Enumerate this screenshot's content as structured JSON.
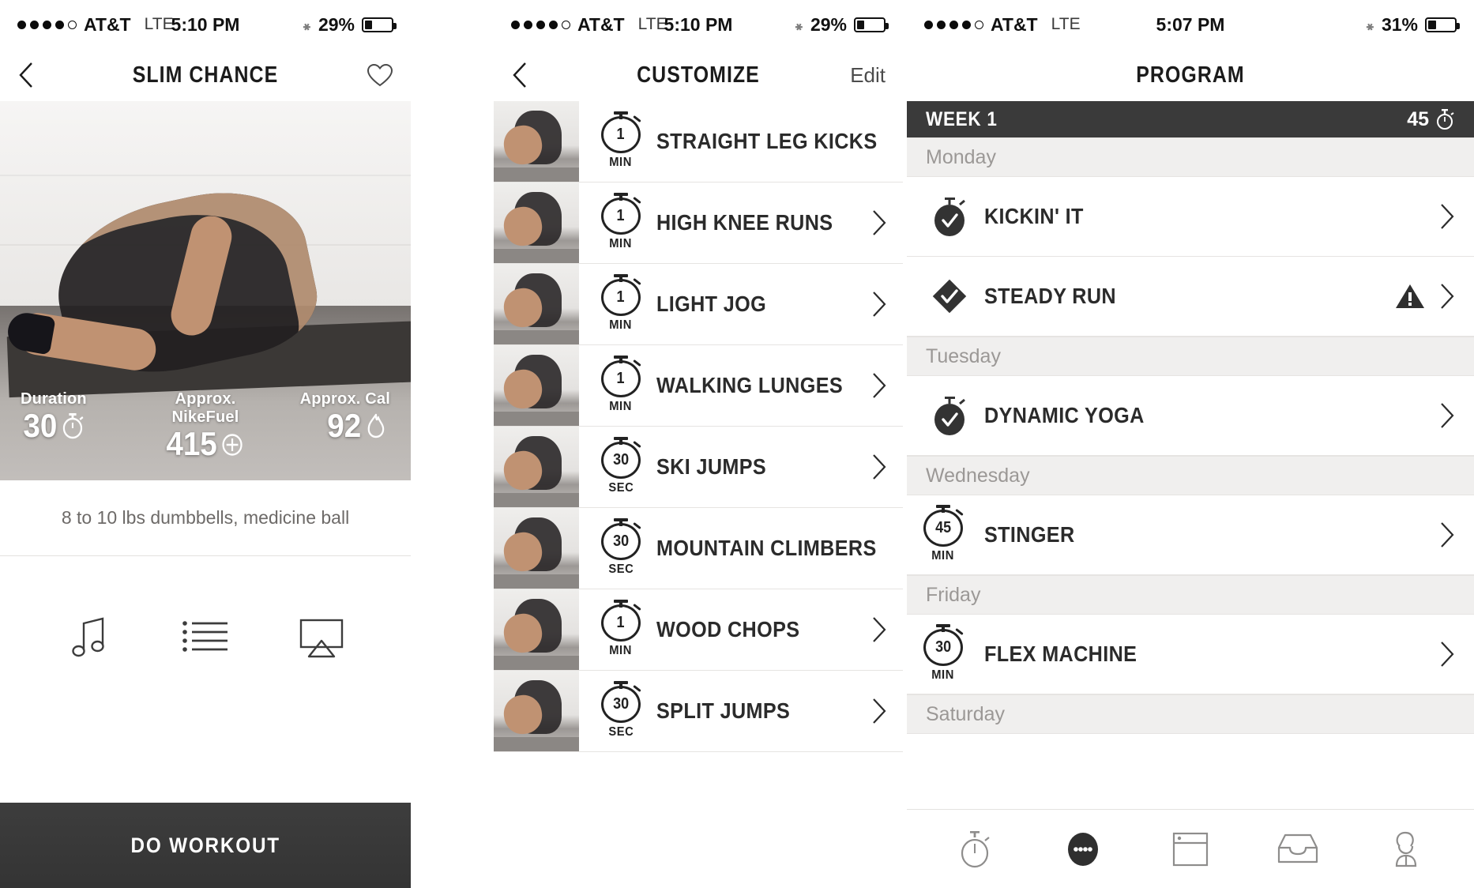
{
  "panel1": {
    "status": {
      "carrier": "AT&T",
      "network": "LTE",
      "time": "5:10 PM",
      "battery_pct": "29%",
      "signal_dots": 5,
      "signal_filled": 4,
      "bluetooth_icon": "bluetooth-icon"
    },
    "nav": {
      "back_icon": "chevron-left-icon",
      "title": "SLIM CHANCE",
      "favorite_icon": "heart-icon"
    },
    "hero": {
      "stats": [
        {
          "label": "Duration",
          "value": "30",
          "icon": "stopwatch-icon"
        },
        {
          "label": "Approx. NikeFuel",
          "value": "415",
          "icon": "fuel-plus-icon"
        },
        {
          "label": "Approx. Cal",
          "value": "92",
          "icon": "flame-icon"
        }
      ]
    },
    "equipment": "8 to 10 lbs dumbbells, medicine ball",
    "tools": [
      {
        "name": "music-note-icon",
        "label": "Music"
      },
      {
        "name": "list-icon",
        "label": "Exercise List"
      },
      {
        "name": "airplay-icon",
        "label": "AirPlay"
      }
    ],
    "cta": "DO WORKOUT"
  },
  "panel2": {
    "status": {
      "carrier": "AT&T",
      "network": "LTE",
      "time": "5:10 PM",
      "battery_pct": "29%",
      "signal_dots": 5,
      "signal_filled": 4,
      "bluetooth_icon": "bluetooth-icon"
    },
    "nav": {
      "back_icon": "chevron-left-icon",
      "title": "CUSTOMIZE",
      "edit_label": "Edit"
    },
    "exercises": [
      {
        "duration": "1",
        "unit": "MIN",
        "name": "STRAIGHT LEG KICKS"
      },
      {
        "duration": "1",
        "unit": "MIN",
        "name": "HIGH KNEE RUNS"
      },
      {
        "duration": "1",
        "unit": "MIN",
        "name": "LIGHT JOG"
      },
      {
        "duration": "1",
        "unit": "MIN",
        "name": "WALKING LUNGES"
      },
      {
        "duration": "30",
        "unit": "SEC",
        "name": "SKI JUMPS"
      },
      {
        "duration": "30",
        "unit": "SEC",
        "name": "MOUNTAIN CLIMBERS"
      },
      {
        "duration": "1",
        "unit": "MIN",
        "name": "WOOD CHOPS"
      },
      {
        "duration": "30",
        "unit": "SEC",
        "name": "SPLIT JUMPS"
      }
    ]
  },
  "panel3": {
    "status": {
      "carrier": "AT&T",
      "network": "LTE",
      "time": "5:07 PM",
      "battery_pct": "31%",
      "signal_dots": 5,
      "signal_filled": 4,
      "bluetooth_icon": "bluetooth-icon"
    },
    "nav": {
      "title": "PROGRAM"
    },
    "week": {
      "label": "WEEK 1",
      "total": "45",
      "icon": "stopwatch-icon"
    },
    "days": [
      {
        "day": "Monday",
        "items": [
          {
            "name": "KICKIN' IT",
            "icon": "stopwatch-check-icon",
            "warning": false
          },
          {
            "name": "STEADY RUN",
            "icon": "diamond-check-icon",
            "warning": true,
            "warning_icon": "warning-triangle-icon"
          }
        ]
      },
      {
        "day": "Tuesday",
        "items": [
          {
            "name": "DYNAMIC YOGA",
            "icon": "stopwatch-check-icon",
            "warning": false
          }
        ]
      },
      {
        "day": "Wednesday",
        "items": [
          {
            "name": "STINGER",
            "icon": "stopwatch-icon",
            "duration": "45",
            "unit": "MIN",
            "warning": false
          }
        ]
      },
      {
        "day": "Friday",
        "items": [
          {
            "name": "FLEX MACHINE",
            "icon": "stopwatch-icon",
            "duration": "30",
            "unit": "MIN",
            "warning": false
          }
        ]
      },
      {
        "day": "Saturday",
        "items": []
      }
    ],
    "tabs": [
      {
        "name": "stopwatch-tab-icon",
        "label": "Workouts",
        "active": false
      },
      {
        "name": "more-dots-tab-icon",
        "label": "More",
        "active": true
      },
      {
        "name": "card-tab-icon",
        "label": "Programs",
        "active": false
      },
      {
        "name": "inbox-tab-icon",
        "label": "Inbox",
        "active": false
      },
      {
        "name": "profile-tab-icon",
        "label": "Profile",
        "active": false
      }
    ]
  },
  "colors": {
    "dark": "#3a3a3a",
    "text": "#2b2b2b",
    "muted": "#9b9896",
    "divider": "#e6e4e2",
    "daybg": "#f0efee"
  }
}
